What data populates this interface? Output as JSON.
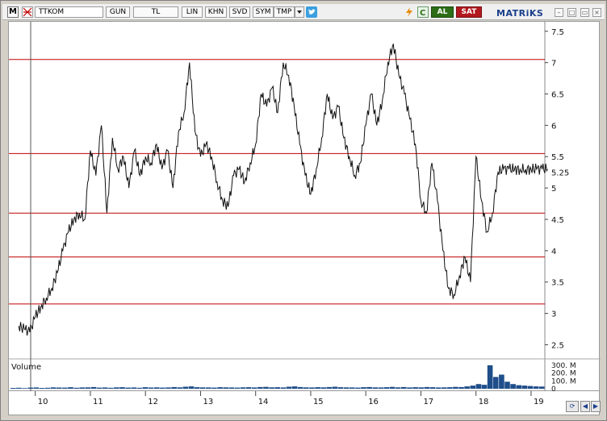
{
  "toolbar": {
    "m_label": "M",
    "symbol": "TTKOM",
    "period": "GUN",
    "currency": "TL",
    "scale": "LIN",
    "khn": "KHN",
    "svd": "SVD",
    "sym": "SYM",
    "tmp": "TMP",
    "buy_label": "AL",
    "sell_label": "SAT",
    "brand": "MATRiKS",
    "icons": [
      "cursor-cross-icon",
      "dropdown-icon",
      "twitter-icon",
      "lightning-icon",
      "refresh-icon"
    ]
  },
  "colors": {
    "price_line": "#111111",
    "level_line": "#c00000",
    "volume_bar": "#1f4e8a",
    "buy": "#2c6e18",
    "sell": "#b1191f",
    "crosshair": "#555555"
  },
  "volume_label": "Volume",
  "chart_data": {
    "type": "line",
    "symbol": "TTKOM",
    "period": "daily",
    "y_axis": {
      "ticks": [
        7.5,
        7,
        6.5,
        6,
        5.5,
        5,
        4.5,
        4,
        3.5,
        3,
        2.5
      ],
      "ylim": [
        2.3,
        7.6
      ],
      "current_value_label": "5.25"
    },
    "x_axis": {
      "ticks": [
        "10",
        "11",
        "12",
        "13",
        "14",
        "15",
        "16",
        "17",
        "18",
        "19"
      ]
    },
    "horizontal_levels": [
      7.05,
      5.55,
      4.6,
      3.9,
      3.15
    ],
    "price_series": {
      "name": "TTKOM",
      "x": [
        9.7,
        9.8,
        9.9,
        10.0,
        10.1,
        10.2,
        10.3,
        10.4,
        10.5,
        10.6,
        10.7,
        10.8,
        10.9,
        11.0,
        11.1,
        11.2,
        11.3,
        11.4,
        11.5,
        11.6,
        11.7,
        11.8,
        11.9,
        12.0,
        12.1,
        12.2,
        12.3,
        12.4,
        12.5,
        12.6,
        12.7,
        12.8,
        12.9,
        13.0,
        13.1,
        13.2,
        13.3,
        13.4,
        13.5,
        13.6,
        13.7,
        13.8,
        13.9,
        14.0,
        14.1,
        14.2,
        14.3,
        14.4,
        14.5,
        14.6,
        14.7,
        14.8,
        14.9,
        15.0,
        15.1,
        15.2,
        15.3,
        15.4,
        15.5,
        15.6,
        15.7,
        15.8,
        15.9,
        16.0,
        16.1,
        16.2,
        16.3,
        16.4,
        16.5,
        16.6,
        16.7,
        16.8,
        16.9,
        17.0,
        17.1,
        17.2,
        17.3,
        17.4,
        17.5,
        17.6,
        17.7,
        17.8,
        17.9,
        18.0,
        18.1,
        18.2,
        18.3,
        18.4,
        18.5,
        18.6,
        18.7,
        18.8,
        18.9,
        19.0,
        19.1,
        19.2,
        19.3
      ],
      "values": [
        2.8,
        2.75,
        2.7,
        2.95,
        3.1,
        3.25,
        3.4,
        3.65,
        4.0,
        4.3,
        4.5,
        4.6,
        4.5,
        5.6,
        5.2,
        6.0,
        4.6,
        5.8,
        5.3,
        5.5,
        5.0,
        5.6,
        5.2,
        5.5,
        5.4,
        5.7,
        5.3,
        5.6,
        5.0,
        5.9,
        6.2,
        7.0,
        5.9,
        5.5,
        5.7,
        5.5,
        5.1,
        4.8,
        4.7,
        5.2,
        5.3,
        5.1,
        5.4,
        5.7,
        6.5,
        6.3,
        6.6,
        6.2,
        7.0,
        6.8,
        6.3,
        5.7,
        5.2,
        4.9,
        5.3,
        5.8,
        6.5,
        6.1,
        6.3,
        5.8,
        5.5,
        5.2,
        5.4,
        6.0,
        6.5,
        6.0,
        6.4,
        7.0,
        7.3,
        6.8,
        6.5,
        6.1,
        5.7,
        4.8,
        4.6,
        5.4,
        4.8,
        4.0,
        3.4,
        3.3,
        3.6,
        3.9,
        3.5,
        5.5,
        4.8,
        4.3,
        4.6,
        5.25,
        5.3,
        5.3,
        5.3,
        5.3,
        5.3,
        5.3,
        5.3,
        5.3,
        5.3
      ]
    },
    "volume": {
      "name": "Volume",
      "y_ticks": [
        "300. M",
        "200. M",
        "100. M",
        "0"
      ],
      "ylim": [
        0,
        350
      ],
      "values_millions": [
        10,
        12,
        8,
        14,
        16,
        10,
        12,
        18,
        15,
        14,
        20,
        12,
        16,
        18,
        22,
        14,
        16,
        12,
        18,
        20,
        14,
        16,
        12,
        20,
        15,
        18,
        14,
        16,
        22,
        18,
        26,
        30,
        20,
        18,
        16,
        14,
        20,
        18,
        16,
        14,
        18,
        20,
        16,
        22,
        24,
        18,
        20,
        16,
        26,
        30,
        22,
        18,
        16,
        20,
        18,
        22,
        26,
        20,
        18,
        16,
        14,
        20,
        22,
        18,
        16,
        20,
        24,
        18,
        22,
        16,
        20,
        18,
        22,
        20,
        16,
        18,
        20,
        24,
        22,
        30,
        40,
        60,
        50,
        300,
        150,
        180,
        90,
        60,
        45,
        40,
        35,
        30,
        28
      ]
    }
  }
}
